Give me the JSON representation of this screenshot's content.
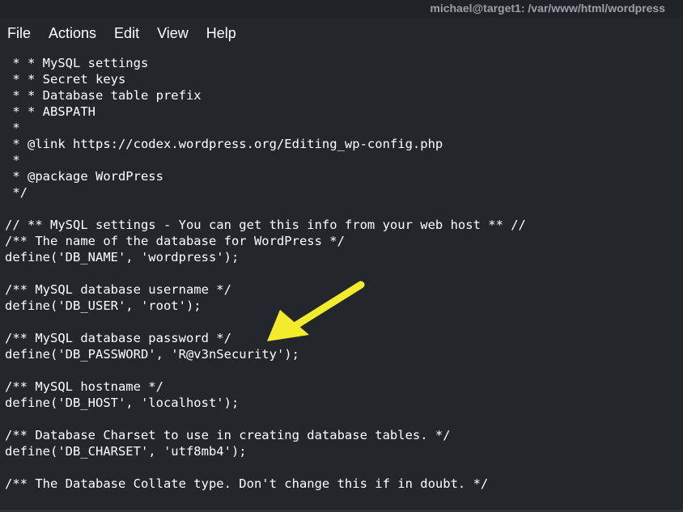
{
  "window": {
    "title": "michael@target1: /var/www/html/wordpress"
  },
  "menu": {
    "items": [
      "File",
      "Actions",
      "Edit",
      "View",
      "Help"
    ]
  },
  "editor": {
    "lines": [
      " * * MySQL settings",
      " * * Secret keys",
      " * * Database table prefix",
      " * * ABSPATH",
      " *",
      " * @link https://codex.wordpress.org/Editing_wp-config.php",
      " *",
      " * @package WordPress",
      " */",
      "",
      "// ** MySQL settings - You can get this info from your web host ** //",
      "/** The name of the database for WordPress */",
      "define('DB_NAME', 'wordpress');",
      "",
      "/** MySQL database username */",
      "define('DB_USER', 'root');",
      "",
      "/** MySQL database password */",
      "define('DB_PASSWORD', 'R@v3nSecurity');",
      "",
      "/** MySQL hostname */",
      "define('DB_HOST', 'localhost');",
      "",
      "/** Database Charset to use in creating database tables. */",
      "define('DB_CHARSET', 'utf8mb4');",
      "",
      "/** The Database Collate type. Don't change this if in doubt. */"
    ]
  },
  "annotation": {
    "icon": "arrow-icon",
    "color": "#f2ec2d"
  }
}
